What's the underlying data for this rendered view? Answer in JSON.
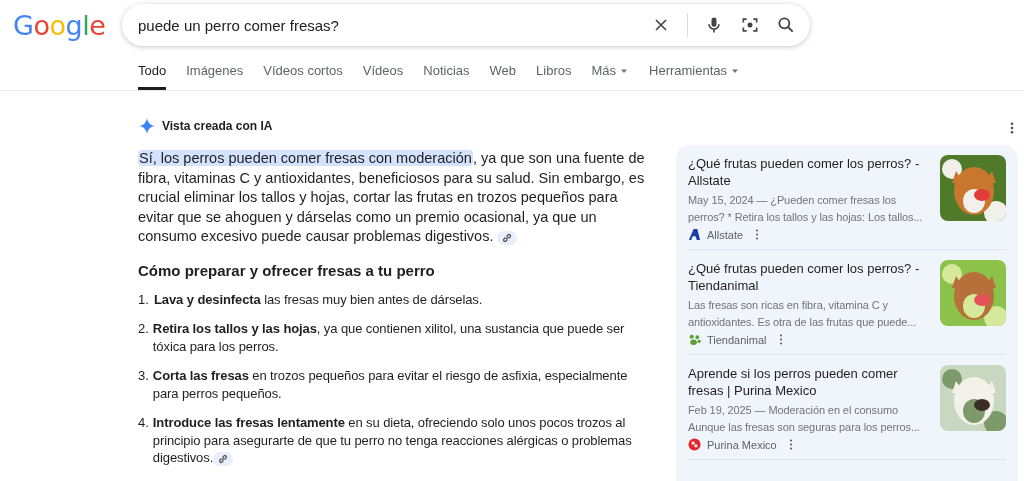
{
  "logo": "Google",
  "search": {
    "value": "puede un perro comer fresas?"
  },
  "tabs": [
    {
      "label": "Todo",
      "selected": true,
      "menu": false
    },
    {
      "label": "Imágenes",
      "selected": false,
      "menu": false
    },
    {
      "label": "Vídeos cortos",
      "selected": false,
      "menu": false
    },
    {
      "label": "Vídeos",
      "selected": false,
      "menu": false
    },
    {
      "label": "Noticias",
      "selected": false,
      "menu": false
    },
    {
      "label": "Web",
      "selected": false,
      "menu": false
    },
    {
      "label": "Libros",
      "selected": false,
      "menu": false
    },
    {
      "label": "Más",
      "selected": false,
      "menu": true
    },
    {
      "label": "Herramientas",
      "selected": false,
      "menu": true
    }
  ],
  "ai_overview": {
    "title": "Vista creada con IA",
    "highlight": "Sí, los perros pueden comer fresas con moderación",
    "text": ", ya que son una fuente de fibra, vitaminas C y antioxidantes, beneficiosos para su salud. Sin embargo, es crucial eliminar los tallos y hojas, cortar las frutas en trozos pequeños para evitar que se ahoguen y dárselas como un premio ocasional, ya que un consumo excesivo puede causar problemas digestivos.",
    "heading": "Cómo preparar y ofrecer fresas a tu perro",
    "steps": [
      {
        "number": "1.",
        "text": "**Lava y desinfecta** las fresas muy bien antes de dárselas.",
        "link": false
      },
      {
        "number": "2.",
        "text": "**Retira los tallos y las hojas**, ya que contienen xilitol, una sustancia que puede ser tóxica para los perros.",
        "link": false
      },
      {
        "number": "3.",
        "text": "**Corta las fresas** en trozos pequeños para evitar el riesgo de asfixia, especialmente para perros pequeños.",
        "link": false
      },
      {
        "number": "4.",
        "text": "**Introduce las fresas lentamente** en su dieta, ofreciendo solo unos pocos trozos al principio para asegurarte de que tu perro no tenga reacciones alérgicas o problemas digestivos.",
        "link": true
      }
    ]
  },
  "sources": [
    {
      "title": "¿Qué frutas pueden comer los perros? - Allstate",
      "snippet": "May 15, 2024 — ¿Pueden comer fresas los perros? * Retira los tallos y las hojas: Los tallos...",
      "site": "Allstate",
      "kind": "letter",
      "color": "#1a3fa8"
    },
    {
      "title": "¿Qué frutas pueden comer los perros? - Tiendanimal",
      "snippet": "Las fresas son ricas en fibra, vitamina C y antioxidantes. Es otra de las frutas que puede...",
      "site": "Tiendanimal",
      "kind": "paw",
      "color": "#5a9e2c"
    },
    {
      "title": "Aprende si los perros pueden comer fresas | Purina Mexico",
      "snippet": "Feb 19, 2025 — Moderación en el consumo Aunque las fresas son seguras para los perros...",
      "site": "Purina Mexico",
      "kind": "check",
      "color": "#e3262f"
    }
  ]
}
